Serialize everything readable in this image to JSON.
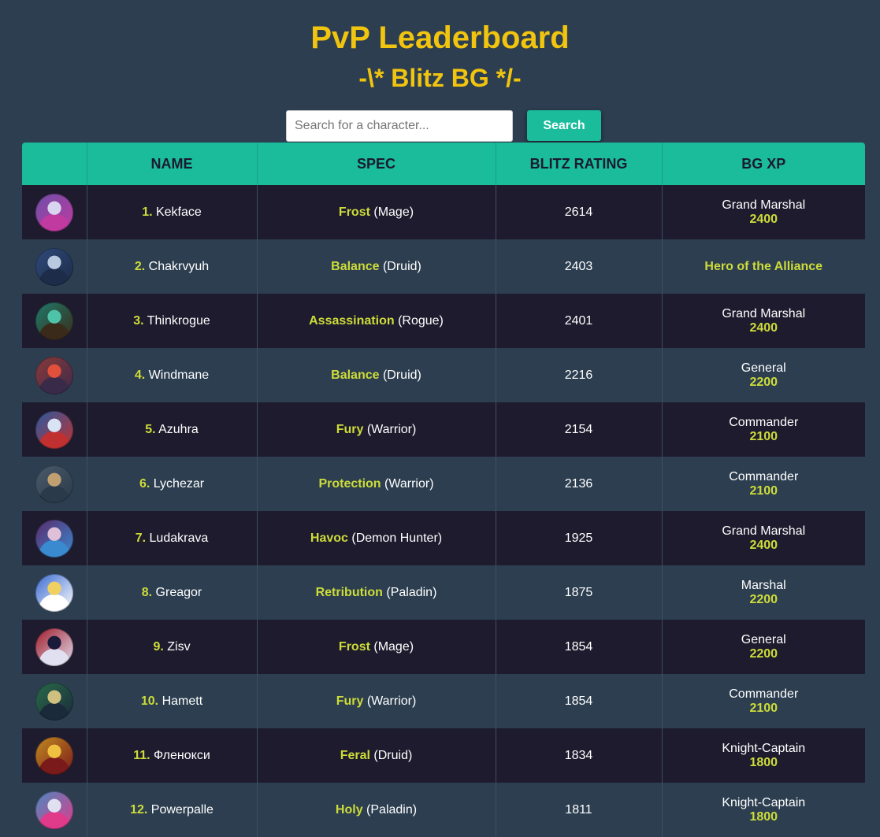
{
  "header": {
    "title": "PvP Leaderboard",
    "subtitle": "-\\* Blitz BG */-"
  },
  "search": {
    "placeholder": "Search for a character...",
    "value": "",
    "button_label": "Search"
  },
  "table": {
    "columns": [
      "",
      "NAME",
      "SPEC",
      "BLITZ RATING",
      "BG XP"
    ],
    "rows": [
      {
        "rank": "1.",
        "name": "Kekface",
        "spec": "Frost",
        "class": "(Mage)",
        "rating": "2614",
        "xp_title": "Grand Marshal",
        "xp_value": "2400",
        "avatar_colors": [
          "#6d4fa8",
          "#d9d4f0",
          "#c03aa0"
        ]
      },
      {
        "rank": "2.",
        "name": "Chakrvyuh",
        "spec": "Balance",
        "class": "(Druid)",
        "rating": "2403",
        "xp_title": "",
        "xp_value": "",
        "xp_highlight": "Hero of the Alliance",
        "avatar_colors": [
          "#2f4a7a",
          "#b9c9e0",
          "#1d2c48"
        ]
      },
      {
        "rank": "3.",
        "name": "Thinkrogue",
        "spec": "Assassination",
        "class": "(Rogue)",
        "rating": "2401",
        "xp_title": "Grand Marshal",
        "xp_value": "2400",
        "avatar_colors": [
          "#1f7a6a",
          "#4fc3a8",
          "#3a2a1a"
        ]
      },
      {
        "rank": "4.",
        "name": "Windmane",
        "spec": "Balance",
        "class": "(Druid)",
        "rating": "2216",
        "xp_title": "General",
        "xp_value": "2200",
        "avatar_colors": [
          "#8a3a3a",
          "#e0503a",
          "#3a2a4a"
        ]
      },
      {
        "rank": "5.",
        "name": "Azuhra",
        "spec": "Fury",
        "class": "(Warrior)",
        "rating": "2154",
        "xp_title": "Commander",
        "xp_value": "2100",
        "avatar_colors": [
          "#2a5aa0",
          "#d8e4f4",
          "#c03030"
        ]
      },
      {
        "rank": "6.",
        "name": "Lychezar",
        "spec": "Protection",
        "class": "(Warrior)",
        "rating": "2136",
        "xp_title": "Commander",
        "xp_value": "2100",
        "avatar_colors": [
          "#4a5a6a",
          "#c0a070",
          "#2a3a4a"
        ]
      },
      {
        "rank": "7.",
        "name": "Ludakrava",
        "spec": "Havoc",
        "class": "(Demon Hunter)",
        "rating": "1925",
        "xp_title": "Grand Marshal",
        "xp_value": "2400",
        "avatar_colors": [
          "#5a2a6a",
          "#e0c0d8",
          "#3a8ad0"
        ]
      },
      {
        "rank": "8.",
        "name": "Greagor",
        "spec": "Retribution",
        "class": "(Paladin)",
        "rating": "1875",
        "xp_title": "Marshal",
        "xp_value": "2200",
        "avatar_colors": [
          "#3a6ad0",
          "#f0d060",
          "#ffffff"
        ]
      },
      {
        "rank": "9.",
        "name": "Zisv",
        "spec": "Frost",
        "class": "(Mage)",
        "rating": "1854",
        "xp_title": "General",
        "xp_value": "2200",
        "avatar_colors": [
          "#a01a2a",
          "#1a1a3a",
          "#e0e0f0"
        ]
      },
      {
        "rank": "10.",
        "name": "Hamett",
        "spec": "Fury",
        "class": "(Warrior)",
        "rating": "1854",
        "xp_title": "Commander",
        "xp_value": "2100",
        "avatar_colors": [
          "#2a6a4a",
          "#d0c080",
          "#1a2a3a"
        ]
      },
      {
        "rank": "11.",
        "name": "Фленокси",
        "spec": "Feral",
        "class": "(Druid)",
        "rating": "1834",
        "xp_title": "Knight-Captain",
        "xp_value": "1800",
        "avatar_colors": [
          "#c08a20",
          "#f0c040",
          "#7a1a1a"
        ]
      },
      {
        "rank": "12.",
        "name": "Powerpalle",
        "spec": "Holy",
        "class": "(Paladin)",
        "rating": "1811",
        "xp_title": "Knight-Captain",
        "xp_value": "1800",
        "avatar_colors": [
          "#4a8ac0",
          "#e0e0f0",
          "#e03a8a"
        ]
      }
    ]
  },
  "colors": {
    "background": "#2c3e50",
    "title": "#f1c40f",
    "accent": "#1abc9c",
    "highlight": "#cddc39",
    "row_dark": "#1e1b2e"
  }
}
